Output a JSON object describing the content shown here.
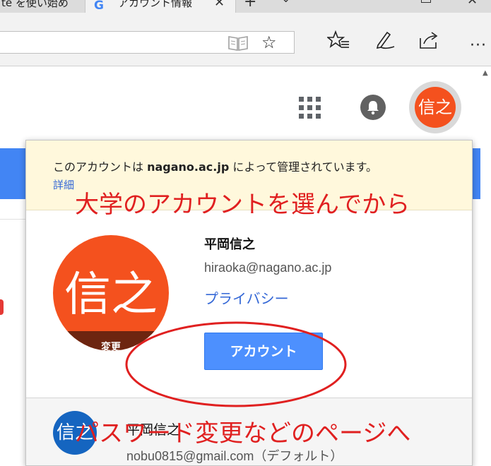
{
  "browser": {
    "inactive_tab_title": "te を使い始め",
    "active_tab_title": "アカウント情報",
    "active_tab_favicon": "G",
    "new_tab_symbol": "+",
    "tab_list_symbol": "⌄",
    "close_symbol": "✕",
    "minimize_symbol": "—",
    "more_symbol": "···"
  },
  "header": {
    "avatar_initials": "信之"
  },
  "account_popup": {
    "notice_prefix": "このアカウントは ",
    "notice_domain": "nagano.ac.jp",
    "notice_suffix": " によって管理されています。",
    "details_link": "詳細",
    "avatar_text": "信之",
    "change_label": "変更",
    "user_name": "平岡信之",
    "user_email": "hiraoka@nagano.ac.jp",
    "privacy_link": "プライバシー",
    "account_button": "アカウント",
    "other_account": {
      "avatar_text": "信之",
      "name": "平岡信之",
      "email": "nobu0815@gmail.com（デフォルト）"
    }
  },
  "annotations": {
    "top": "大学のアカウントを選んでから",
    "bottom": "パスワード変更などのページへ"
  },
  "colors": {
    "avatar": "#f4511e",
    "account_button": "#4d90fe",
    "link": "#3367d6",
    "annotation": "#e02020",
    "notice_bg": "#fff8dc"
  }
}
